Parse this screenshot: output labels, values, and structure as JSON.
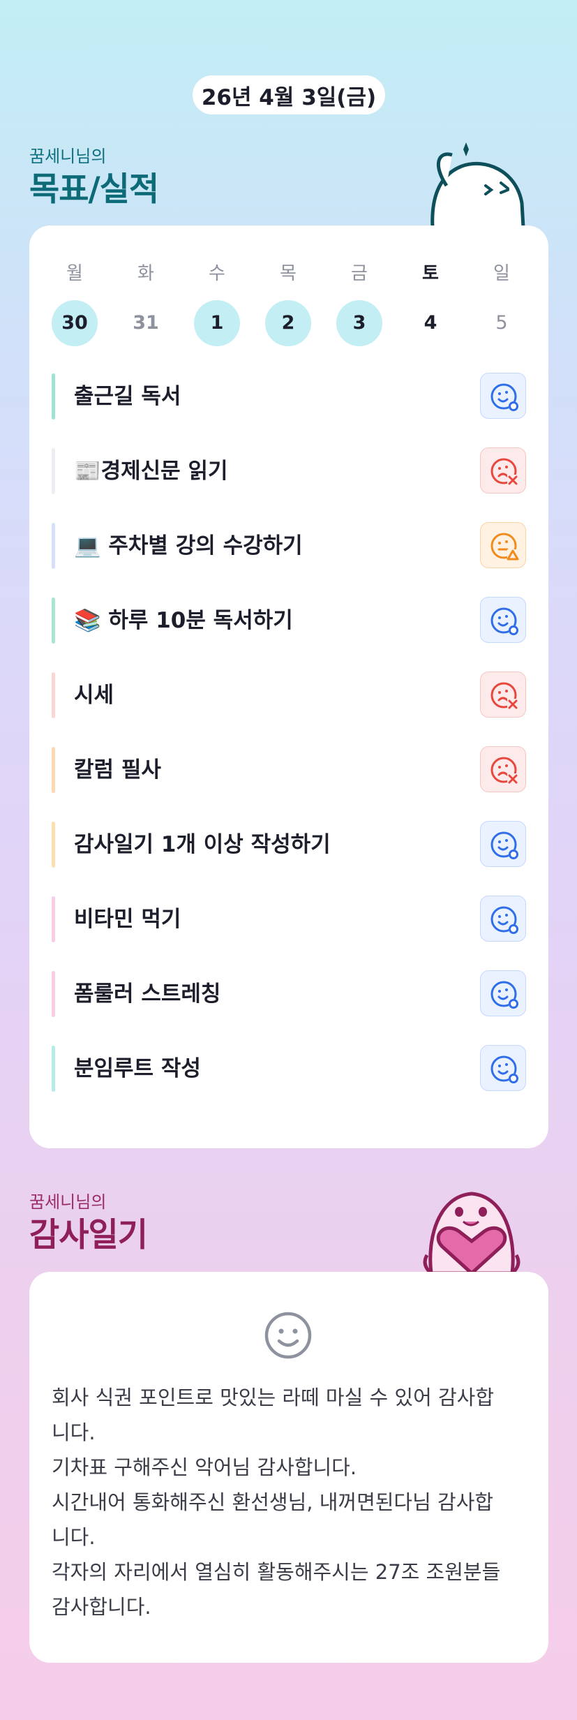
{
  "date_label": "26년 4월 3일(금)",
  "goals_section": {
    "owner": "꿈세니님의",
    "title": "목표/실적",
    "weekdays": [
      "월",
      "화",
      "수",
      "목",
      "금",
      "토",
      "일"
    ],
    "days": [
      "30",
      "31",
      "1",
      "2",
      "3",
      "4",
      "5"
    ],
    "items": [
      {
        "label": "출근길 독서",
        "status": "done",
        "bar_color": "#9fe3d3"
      },
      {
        "label": "📰경제신문 읽기",
        "status": "fail",
        "bar_color": "#eceef2"
      },
      {
        "label": "💻 주차별 강의 수강하기",
        "status": "partial",
        "bar_color": "#d6e0fb"
      },
      {
        "label": "📚 하루 10분 독서하기",
        "status": "done",
        "bar_color": "#a8e6d0"
      },
      {
        "label": "시세",
        "status": "fail",
        "bar_color": "#fcd6d4"
      },
      {
        "label": "칼럼 필사",
        "status": "fail",
        "bar_color": "#fbd9b3"
      },
      {
        "label": "감사일기 1개 이상 작성하기",
        "status": "done",
        "bar_color": "#fce0b0"
      },
      {
        "label": "비타민 먹기",
        "status": "done",
        "bar_color": "#f9cde6"
      },
      {
        "label": "폼룰러 스트레칭",
        "status": "done",
        "bar_color": "#f9cde6"
      },
      {
        "label": "분임루트 작성",
        "status": "done",
        "bar_color": "#b6ece8"
      }
    ]
  },
  "thanks_section": {
    "owner": "꿈세니님의",
    "title": "감사일기",
    "text": "회사 식권 포인트로 맛있는 라떼 마실 수 있어 감사합\n니다.\n기차표 구해주신 악어님 감사합니다.\n시간내어 통화해주신 환선생님, 내꺼면된다님 감사합\n니다.\n각자의 자리에서 열심히 활동해주시는 27조 조원분들\n감사합니다."
  },
  "colors": {
    "done": "#2f6ee8",
    "fail": "#e8473e",
    "partial": "#f08b1e",
    "title_teal": "#0d6b78",
    "title_pink": "#8e1f58"
  },
  "icons": {
    "done": "smile-circle-icon",
    "fail": "sad-x-icon",
    "partial": "neutral-triangle-icon",
    "thanks": "smiley-outline-icon"
  }
}
